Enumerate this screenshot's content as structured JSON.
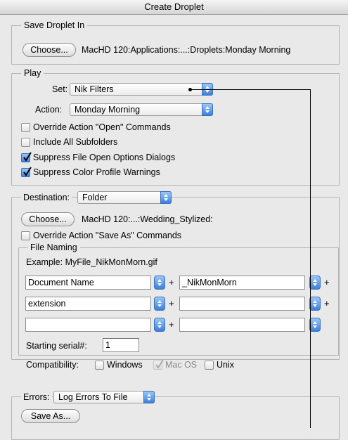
{
  "window": {
    "title": "Create Droplet"
  },
  "save_in": {
    "group_label": "Save Droplet In",
    "choose_label": "Choose...",
    "path": "MacHD 120:Applications:...:Droplets:Monday Morning"
  },
  "play": {
    "group_label": "Play",
    "set_label": "Set:",
    "set_value": "Nik Filters",
    "action_label": "Action:",
    "action_value": "Monday Morning",
    "checkboxes": [
      {
        "label": "Override Action \"Open\" Commands",
        "checked": false
      },
      {
        "label": "Include All Subfolders",
        "checked": false
      },
      {
        "label": "Suppress File Open Options Dialogs",
        "checked": true
      },
      {
        "label": "Suppress Color Profile Warnings",
        "checked": true
      }
    ]
  },
  "destination": {
    "label": "Destination:",
    "value": "Folder",
    "choose_label": "Choose...",
    "path": "MacHD 120:...:Wedding_Stylized:",
    "override_label": "Override Action \"Save As\" Commands",
    "override_checked": false,
    "file_naming": {
      "group_label": "File Naming",
      "example": "Example: MyFile_NikMonMorn.gif",
      "rows": [
        {
          "left": "Document Name",
          "right": "_NikMonMorn"
        },
        {
          "left": "extension",
          "right": ""
        },
        {
          "left": "",
          "right": ""
        }
      ],
      "plus": "+",
      "serial_label": "Starting serial#:",
      "serial_value": "1",
      "compat_label": "Compatibility:",
      "compat": [
        {
          "label": "Windows",
          "checked": false,
          "disabled": false
        },
        {
          "label": "Mac OS",
          "checked": true,
          "disabled": true
        },
        {
          "label": "Unix",
          "checked": false,
          "disabled": false
        }
      ]
    }
  },
  "errors": {
    "label": "Errors:",
    "value": "Log Errors To File",
    "save_as_label": "Save As..."
  },
  "colors": {
    "accent": "#3d7fdc",
    "window_bg": "#e9e9e9"
  }
}
